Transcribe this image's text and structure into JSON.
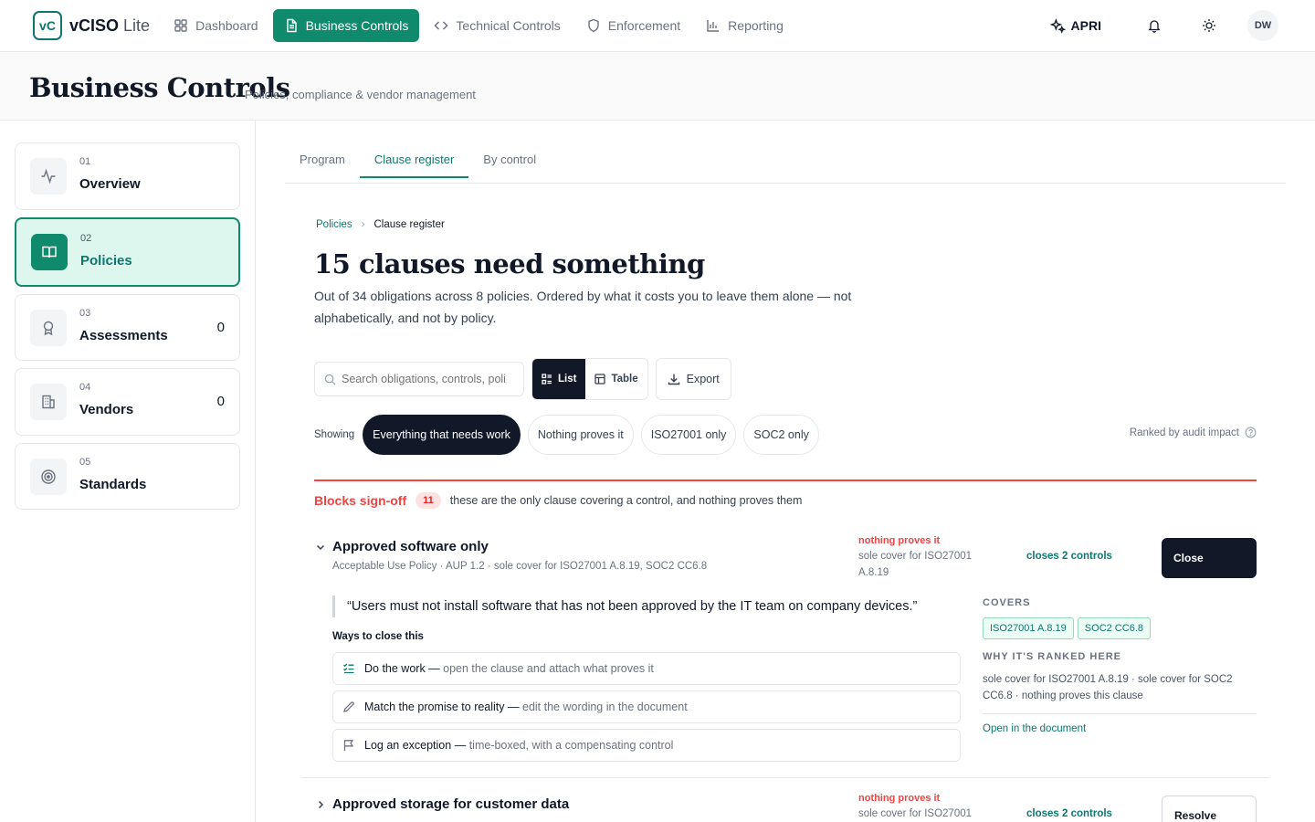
{
  "app": {
    "logo": "vC",
    "name": "vCISO",
    "name_suffix": "Lite"
  },
  "nav": [
    {
      "label": "Dashboard",
      "icon": "grid-icon",
      "active": false
    },
    {
      "label": "Business Controls",
      "icon": "document-icon",
      "active": true
    },
    {
      "label": "Technical Controls",
      "icon": "code-icon",
      "active": false
    },
    {
      "label": "Enforcement",
      "icon": "shield-icon",
      "active": false
    },
    {
      "label": "Reporting",
      "icon": "bar-chart-icon",
      "active": false
    }
  ],
  "topbar": {
    "assistant_label": "APRI",
    "avatar_initials": "DW"
  },
  "page": {
    "title": "Business Controls",
    "subtitle": "Policies, compliance & vendor management"
  },
  "sidebar": {
    "items": [
      {
        "num": "01",
        "label": "Overview",
        "count": "",
        "icon": "activity-icon",
        "active": false
      },
      {
        "num": "02",
        "label": "Policies",
        "count": "",
        "icon": "book-icon",
        "active": true
      },
      {
        "num": "03",
        "label": "Assessments",
        "count": "0",
        "icon": "award-icon",
        "active": false
      },
      {
        "num": "04",
        "label": "Vendors",
        "count": "0",
        "icon": "building-icon",
        "active": false
      },
      {
        "num": "05",
        "label": "Standards",
        "count": "",
        "icon": "target-icon",
        "active": false
      }
    ]
  },
  "tabs": [
    {
      "label": "Program",
      "active": false
    },
    {
      "label": "Clause register",
      "active": true
    },
    {
      "label": "By control",
      "active": false
    }
  ],
  "breadcrumb": {
    "parent": "Policies",
    "current": "Clause register"
  },
  "main": {
    "headline": "15 clauses need something",
    "lede": "Out of 34 obligations across 8 policies. Ordered by what it costs you to leave them alone — not alphabetically, and not by policy."
  },
  "toolbar": {
    "search_placeholder": "Search obligations, controls, poli",
    "view_list": "List",
    "view_table": "Table",
    "export": "Export"
  },
  "filters": {
    "showing_label": "Showing",
    "chips": [
      {
        "label": "Everything that needs work",
        "active": true
      },
      {
        "label": "Nothing proves it",
        "active": false
      },
      {
        "label": "ISO27001 only",
        "active": false
      },
      {
        "label": "SOC2 only",
        "active": false
      }
    ],
    "ranked_label": "Ranked by audit impact"
  },
  "group": {
    "title": "Blocks sign-off",
    "count": "11",
    "description": "these are the only clause covering a control, and nothing proves them"
  },
  "clauses": [
    {
      "title": "Approved software only",
      "meta": "Acceptable Use Policy · AUP 1.2 · sole cover for ISO27001 A.8.19, SOC2 CC6.8",
      "status": "nothing proves it",
      "status_note": "sole cover for ISO27001 A.8.19",
      "closes": "closes 2 controls",
      "action": "Close",
      "expanded": true,
      "quote": "“Users must not install software that has not been approved by the IT team on company devices.”",
      "ways_label": "Ways to close this",
      "ways": [
        {
          "strong": "Do the work —",
          "dim": "open the clause and attach what proves it",
          "icon": "checklist-icon"
        },
        {
          "strong": "Match the promise to reality —",
          "dim": "edit the wording in the document",
          "icon": "pencil-icon"
        },
        {
          "strong": "Log an exception —",
          "dim": "time-boxed, with a compensating control",
          "icon": "flag-icon"
        }
      ],
      "covers_label": "COVERS",
      "covers": [
        "ISO27001 A.8.19",
        "SOC2 CC6.8"
      ],
      "why_label": "WHY IT'S RANKED HERE",
      "why": "sole cover for ISO27001 A.8.19 · sole cover for SOC2 CC6.8 · nothing proves this clause",
      "open_link": "Open in the document"
    },
    {
      "title": "Approved storage for customer data",
      "status": "nothing proves it",
      "status_note": "sole cover for ISO27001",
      "closes": "closes 2 controls",
      "action": "Resolve",
      "expanded": false
    }
  ],
  "colors": {
    "accent": "#0f8a6c",
    "accent_text": "#0f766e",
    "danger": "#ef4444",
    "dark": "#111827"
  }
}
